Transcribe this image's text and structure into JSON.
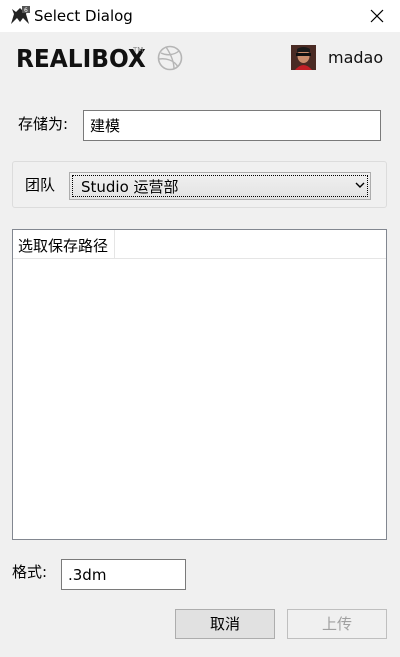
{
  "window": {
    "title": "Select Dialog"
  },
  "header": {
    "logo_text": "REALIBOX",
    "logo_tm": "TM",
    "username": "madao"
  },
  "form": {
    "save_as_label": "存储为:",
    "save_as_value": "建模",
    "team_label": "团队",
    "team_selected": "Studio 运营部",
    "table": {
      "columns": [
        "选取保存路径"
      ],
      "rows": []
    },
    "format_label": "格式:",
    "format_value": ".3dm"
  },
  "buttons": {
    "cancel": "取消",
    "upload": "上传"
  },
  "icons": [
    "app-icon",
    "close-icon",
    "dribbble-icon",
    "avatar",
    "chevron-down-icon"
  ]
}
